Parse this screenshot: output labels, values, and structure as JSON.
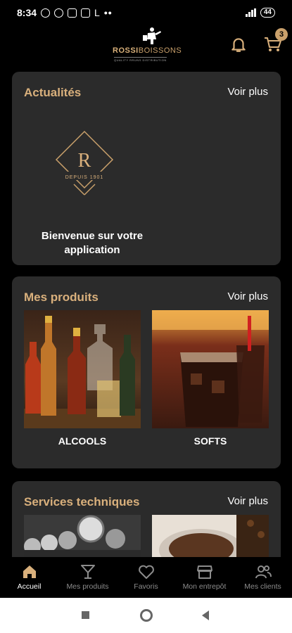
{
  "status_bar": {
    "time": "8:34",
    "extra_letter": "L",
    "battery": "44"
  },
  "header": {
    "brand_main": "ROSSI",
    "brand_secondary": "BOISSONS",
    "brand_tagline": "QUALITY RRUNS DISTRIBUTION",
    "cart_count": "3"
  },
  "news": {
    "title": "Actualités",
    "more": "Voir plus",
    "logo_letter": "R",
    "logo_since": "DEPUIS 1901",
    "caption": "Bienvenue sur votre application"
  },
  "products": {
    "title": "Mes produits",
    "more": "Voir plus",
    "items": [
      {
        "label": "ALCOOLS"
      },
      {
        "label": "SOFTS"
      }
    ]
  },
  "services": {
    "title": "Services techniques",
    "more": "Voir plus"
  },
  "tabs": [
    {
      "label": "Accueil",
      "icon": "home-icon",
      "active": true
    },
    {
      "label": "Mes produits",
      "icon": "cocktail-glass-icon"
    },
    {
      "label": "Favoris",
      "icon": "heart-icon"
    },
    {
      "label": "Mon entrepôt",
      "icon": "store-icon"
    },
    {
      "label": "Mes clients",
      "icon": "users-icon"
    }
  ],
  "colors": {
    "accent": "#d9b07c",
    "card_background": "#2b2b2b",
    "background": "#000000"
  }
}
